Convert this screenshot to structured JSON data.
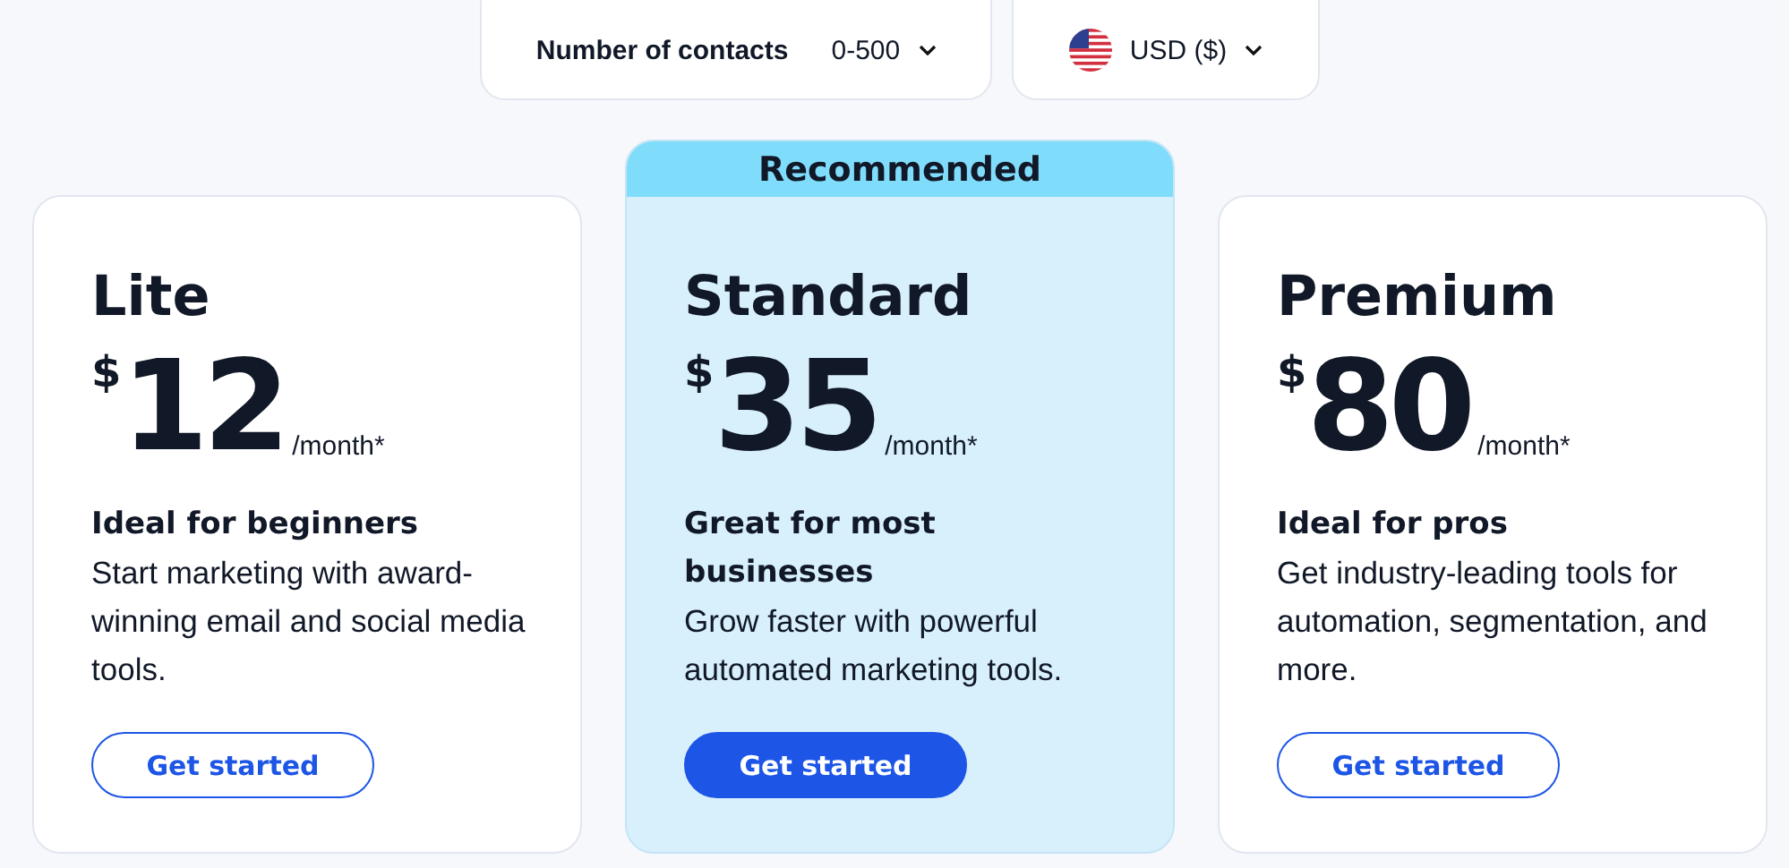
{
  "filters": {
    "contacts_label": "Number of contacts",
    "contacts_value": "0-500",
    "currency": "USD ($)"
  },
  "plans": [
    {
      "name": "Lite",
      "featured": false,
      "currency_symbol": "$",
      "price": "12",
      "period": "/month*",
      "headline": "Ideal for beginners",
      "description": "Start marketing with award-winning email and social media tools.",
      "button": "Get started"
    },
    {
      "name": "Standard",
      "featured": true,
      "badge": "Recommended",
      "currency_symbol": "$",
      "price": "35",
      "period": "/month*",
      "headline": "Great for most businesses",
      "description": "Grow faster with powerful automated marketing tools.",
      "button": "Get started"
    },
    {
      "name": "Premium",
      "featured": false,
      "currency_symbol": "$",
      "price": "80",
      "period": "/month*",
      "headline": "Ideal for pros",
      "description": "Get industry-leading tools for automation, segmentation, and more.",
      "button": "Get started"
    }
  ]
}
